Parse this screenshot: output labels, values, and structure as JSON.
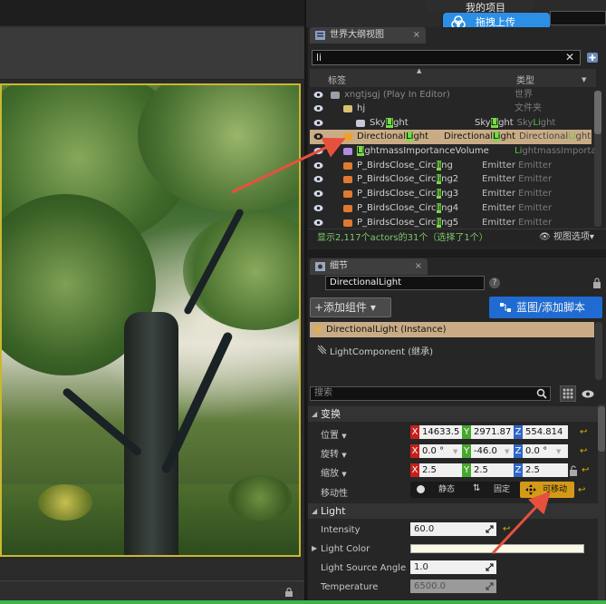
{
  "top_bar": {
    "project_label": "我的项目",
    "upload_label": "拖拽上传"
  },
  "outliner": {
    "tab_title": "世界大纲视图",
    "search_value": "li",
    "col_label": "标签",
    "col_type": "类型",
    "rows": [
      {
        "pre": "xngtjsgj (Play In Editor)",
        "hl": "",
        "post": "",
        "type": "世界",
        "type_pre": "",
        "type_hl": "",
        "type_post": ""
      },
      {
        "pre": "hj",
        "hl": "",
        "post": "",
        "type": "文件夹",
        "type_pre": "",
        "type_hl": "",
        "type_post": ""
      },
      {
        "pre": "Sky",
        "hl": "Li",
        "post": "ght",
        "type": "",
        "type_pre": "Sky",
        "type_hl": "Li",
        "type_post": "ght"
      },
      {
        "pre": "Directional",
        "hl": "Li",
        "post": "ght",
        "type": "",
        "type_pre": "Directional",
        "type_hl": "Li",
        "type_post": "ght"
      },
      {
        "pre": "",
        "hl": "Li",
        "post": "ghtmassImportanceVolume",
        "type": "",
        "type_pre": "",
        "type_hl": "Li",
        "type_post": "ghtmassImporta"
      },
      {
        "pre": "P_BirdsClose_Circ",
        "hl": "li",
        "post": "ng",
        "type": "Emitter",
        "type_pre": "",
        "type_hl": "",
        "type_post": ""
      },
      {
        "pre": "P_BirdsClose_Circ",
        "hl": "li",
        "post": "ng2",
        "type": "Emitter",
        "type_pre": "",
        "type_hl": "",
        "type_post": ""
      },
      {
        "pre": "P_BirdsClose_Circ",
        "hl": "li",
        "post": "ng3",
        "type": "Emitter",
        "type_pre": "",
        "type_hl": "",
        "type_post": ""
      },
      {
        "pre": "P_BirdsClose_Circ",
        "hl": "li",
        "post": "ng4",
        "type": "Emitter",
        "type_pre": "",
        "type_hl": "",
        "type_post": ""
      },
      {
        "pre": "P_BirdsClose_Circ",
        "hl": "li",
        "post": "ng5",
        "type": "Emitter",
        "type_pre": "",
        "type_hl": "",
        "type_post": ""
      }
    ],
    "status_text": "显示2,117个actors的31个（选择了1个）",
    "view_options": "视图选项"
  },
  "details": {
    "tab_title": "细节",
    "name_value": "DirectionalLight",
    "add_component": "+添加组件",
    "blueprint": "蓝图/添加脚本",
    "component_instance": "DirectionalLight (Instance)",
    "component_child": "LightComponent (继承)",
    "search_placeholder": "搜索",
    "transform": {
      "section": "变换",
      "location_label": "位置",
      "rotation_label": "旋转",
      "scale_label": "缩放",
      "mobility_label": "移动性",
      "location": {
        "x": "14633.5",
        "y": "2971.87",
        "z": "554.814"
      },
      "rotation": {
        "x": "0.0 °",
        "y": "-46.0",
        "z": "0.0 °"
      },
      "scale": {
        "x": "2.5",
        "y": "2.5",
        "z": "2.5"
      },
      "mobility": {
        "static": "静态",
        "stationary": "固定",
        "movable": "可移动"
      }
    },
    "light": {
      "section": "Light",
      "intensity_label": "Intensity",
      "intensity_value": "60.0",
      "color_label": "Light Color",
      "angle_label": "Light Source Angle",
      "angle_value": "1.0",
      "temperature_label": "Temperature",
      "temperature_value": "6500.0"
    }
  },
  "axis_letters": {
    "x": "X",
    "y": "Y",
    "z": "Z"
  },
  "colors": {
    "selection": "#c9ac86",
    "highlight": "#7ad94e",
    "blueprint_button": "#1f6bd1",
    "movable": "#d49a17",
    "viewport_border": "#c9b830",
    "annotation_arrow": "#e8503e"
  }
}
